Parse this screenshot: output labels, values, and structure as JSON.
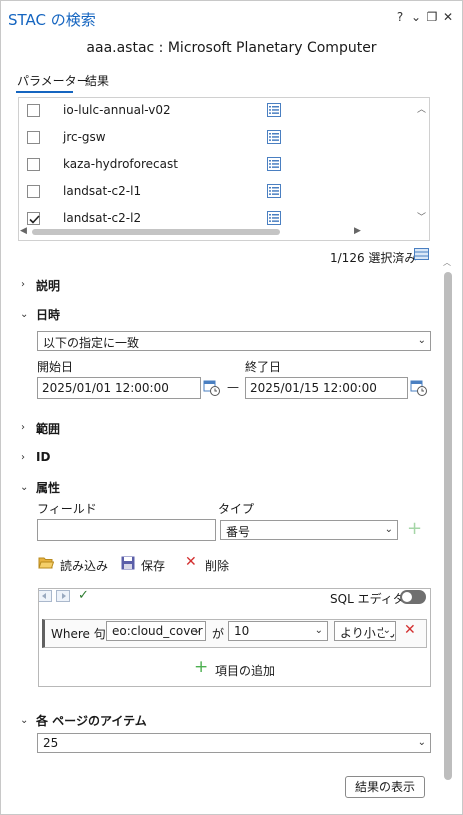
{
  "window": {
    "title": "STAC の検索",
    "subtitle": "aaa.astac : Microsoft Planetary Computer",
    "controls": [
      "?",
      "⌄",
      "❐",
      "✕"
    ]
  },
  "tabs": [
    {
      "label": "パラメーター",
      "active": true
    },
    {
      "label": "結果",
      "active": false
    }
  ],
  "collections": {
    "items": [
      {
        "label": "io-lulc-annual-v02",
        "checked": false
      },
      {
        "label": "jrc-gsw",
        "checked": false
      },
      {
        "label": "kaza-hydroforecast",
        "checked": false
      },
      {
        "label": "landsat-c2-l1",
        "checked": false
      },
      {
        "label": "landsat-c2-l2",
        "checked": true
      }
    ],
    "selected_count": "1/126 選択済み"
  },
  "sections": {
    "description": "説明",
    "datetime": "日時",
    "extent": "範囲",
    "id": "ID",
    "attributes": "属性",
    "page_items": "各 ページのアイテム"
  },
  "datetime": {
    "mode": "以下の指定に一致",
    "start_label": "開始日",
    "start_value": "2025/01/01 12:00:00",
    "separator": "—",
    "end_label": "終了日",
    "end_value": "2025/01/15 12:00:00"
  },
  "attributes": {
    "field_label": "フィールド",
    "field_value": "",
    "type_label": "タイプ",
    "type_value": "番号",
    "load_label": "読み込み",
    "save_label": "保存",
    "delete_label": "削除",
    "sql_editor_label": "SQL エディター",
    "clause": {
      "where_label": "Where 句",
      "field": "eo:cloud_cover",
      "connector": "が",
      "value": "10",
      "operator": "より小さい"
    },
    "add_item_label": "項目の追加"
  },
  "page_items_value": "25",
  "show_results_label": "結果の表示",
  "colors": {
    "accent": "#1565c0",
    "delete": "#d32f2f",
    "add": "#4caf50"
  }
}
